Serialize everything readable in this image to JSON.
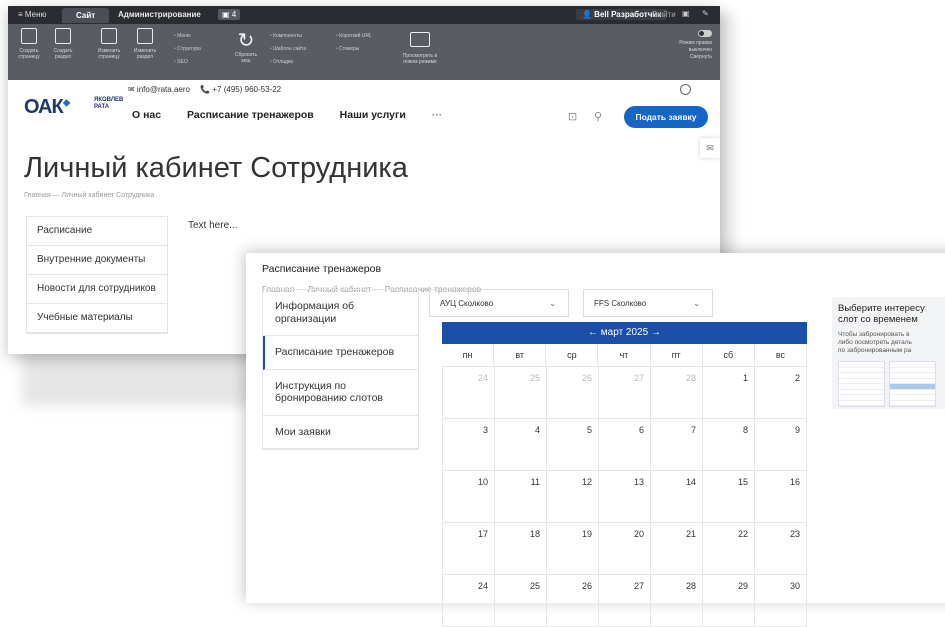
{
  "admin_bar": {
    "menu": "≡ Меню",
    "tab_site": "Сайт",
    "tab_admin": "Администрирование",
    "notif": "▣ 4",
    "user": "👤 Bell Разработчик",
    "logout": "Выйти",
    "toolbar": [
      {
        "label": "Создать страницу",
        "icon": "new-page-icon"
      },
      {
        "label": "Создать раздел",
        "icon": "new-section-icon"
      },
      {
        "label": "Изменить страницу",
        "icon": "edit-page-icon"
      },
      {
        "label": "Изменить раздел",
        "icon": "edit-section-icon"
      }
    ],
    "list1": [
      "Меню",
      "Структура",
      "SEO"
    ],
    "refresh": "Сбросить кеш",
    "list2": [
      "Компоненты",
      "Шаблон сайта",
      "Отладка"
    ],
    "list3": [
      "Короткий URL",
      "Стикеры"
    ],
    "preview": "Просмотреть в новом режиме",
    "right": [
      "Режим правки",
      "выключен",
      "Свернуть"
    ]
  },
  "site": {
    "logo": "ОАК",
    "logo_sub": [
      "ЯКОВЛЕВ",
      "РАТА"
    ],
    "email": "✉ info@rata.aero",
    "phone": "📞 +7 (495) 960-53-22",
    "nav": [
      "О нас",
      "Расписание тренажеров",
      "Наши услуги",
      "···"
    ],
    "apply": "Подать заявку"
  },
  "back_page": {
    "title": "Личный кабинет Сотрудника",
    "breadcrumb": "Главная — Личный кабинет Сотрудника",
    "menu": [
      "Расписание",
      "Внутренние документы",
      "Новости для сотрудников",
      "Учебные материалы"
    ],
    "content": "Text here..."
  },
  "front_page": {
    "title": "Расписание тренажеров",
    "breadcrumb": "Главная — Личный кабинет — Расписание тренажеров",
    "menu": [
      "Информация об организации",
      "Расписание тренажеров",
      "Инструкция по бронированию слотов",
      "Мои заявки"
    ],
    "select1": "АУЦ Сколково",
    "select2": "FFS Сколково",
    "month": "март 2025",
    "weekdays": [
      "пн",
      "вт",
      "ср",
      "чт",
      "пт",
      "сб",
      "вс"
    ],
    "days": [
      {
        "d": "24",
        "muted": true
      },
      {
        "d": "25",
        "muted": true
      },
      {
        "d": "26",
        "muted": true
      },
      {
        "d": "27",
        "muted": true
      },
      {
        "d": "28",
        "muted": true
      },
      {
        "d": "1"
      },
      {
        "d": "2"
      },
      {
        "d": "3"
      },
      {
        "d": "4"
      },
      {
        "d": "5"
      },
      {
        "d": "6"
      },
      {
        "d": "7"
      },
      {
        "d": "8"
      },
      {
        "d": "9"
      },
      {
        "d": "10"
      },
      {
        "d": "11"
      },
      {
        "d": "12"
      },
      {
        "d": "13"
      },
      {
        "d": "14"
      },
      {
        "d": "15"
      },
      {
        "d": "16"
      },
      {
        "d": "17"
      },
      {
        "d": "18"
      },
      {
        "d": "19"
      },
      {
        "d": "20"
      },
      {
        "d": "21"
      },
      {
        "d": "22"
      },
      {
        "d": "23"
      },
      {
        "d": "24"
      },
      {
        "d": "25"
      },
      {
        "d": "26"
      },
      {
        "d": "27"
      },
      {
        "d": "28"
      },
      {
        "d": "29"
      },
      {
        "d": "30"
      }
    ],
    "slot_card": {
      "title": [
        "Выберите интересу",
        "слот со временем"
      ],
      "text": [
        "Чтобы забронировать в",
        "либо посмотреть деталь",
        "по забронированным ра"
      ]
    }
  },
  "colors": {
    "brand_blue": "#1565c7",
    "calendar_blue": "#1a4ea8",
    "admin_dark": "#2a2c31",
    "toolbar_gray": "#595c63"
  }
}
